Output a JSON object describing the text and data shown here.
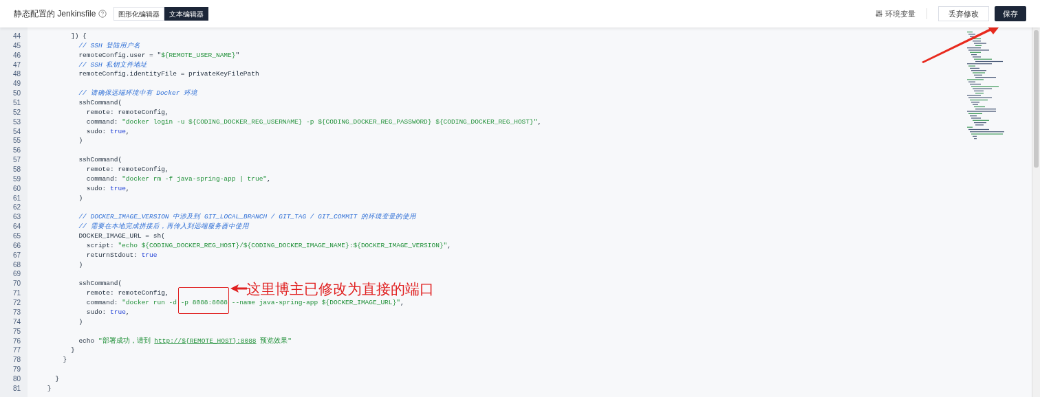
{
  "header": {
    "title": "静态配置的 Jenkinsfile",
    "mode_tabs": [
      {
        "label": "图形化编辑器",
        "selected": false
      },
      {
        "label": "文本编辑器",
        "selected": true
      }
    ],
    "env_button": "环境变量",
    "discard_button": "丢弃修改",
    "save_button": "保存"
  },
  "editor": {
    "lines": [
      {
        "number": "44",
        "segments": [
          {
            "kind": "plain",
            "text": "          ]) {"
          }
        ]
      },
      {
        "number": "45",
        "segments": [
          {
            "kind": "comment",
            "text": "            // SSH 登陆用户名"
          }
        ]
      },
      {
        "number": "46",
        "segments": [
          {
            "kind": "plain",
            "text": "            remoteConfig.user = \""
          },
          {
            "kind": "string",
            "text": "${REMOTE_USER_NAME}"
          },
          {
            "kind": "plain",
            "text": "\""
          }
        ]
      },
      {
        "number": "47",
        "segments": [
          {
            "kind": "comment",
            "text": "            // SSH 私钥文件地址"
          }
        ]
      },
      {
        "number": "48",
        "segments": [
          {
            "kind": "plain",
            "text": "            remoteConfig.identityFile = privateKeyFilePath"
          }
        ]
      },
      {
        "number": "49"
      },
      {
        "number": "50",
        "segments": [
          {
            "kind": "comment",
            "text": "            // 请确保远端环境中有 Docker 环境"
          }
        ]
      },
      {
        "number": "51",
        "segments": [
          {
            "kind": "plain",
            "text": "            sshCommand("
          }
        ]
      },
      {
        "number": "52",
        "segments": [
          {
            "kind": "plain",
            "text": "              remote: remoteConfig,"
          }
        ]
      },
      {
        "number": "53",
        "segments": [
          {
            "kind": "plain",
            "text": "              command: "
          },
          {
            "kind": "string",
            "text": "\"docker login -u ${CODING_DOCKER_REG_USERNAME} -p ${CODING_DOCKER_REG_PASSWORD} ${CODING_DOCKER_REG_HOST}\""
          },
          {
            "kind": "plain",
            "text": ","
          }
        ]
      },
      {
        "number": "54",
        "segments": [
          {
            "kind": "plain",
            "text": "              sudo: "
          },
          {
            "kind": "keyword",
            "text": "true"
          },
          {
            "kind": "plain",
            "text": ","
          }
        ]
      },
      {
        "number": "55",
        "segments": [
          {
            "kind": "plain",
            "text": "            )"
          }
        ]
      },
      {
        "number": "56"
      },
      {
        "number": "57",
        "segments": [
          {
            "kind": "plain",
            "text": "            sshCommand("
          }
        ]
      },
      {
        "number": "58",
        "segments": [
          {
            "kind": "plain",
            "text": "              remote: remoteConfig,"
          }
        ]
      },
      {
        "number": "59",
        "segments": [
          {
            "kind": "plain",
            "text": "              command: "
          },
          {
            "kind": "string",
            "text": "\"docker rm -f java-spring-app | true\""
          },
          {
            "kind": "plain",
            "text": ","
          }
        ]
      },
      {
        "number": "60",
        "segments": [
          {
            "kind": "plain",
            "text": "              sudo: "
          },
          {
            "kind": "keyword",
            "text": "true"
          },
          {
            "kind": "plain",
            "text": ","
          }
        ]
      },
      {
        "number": "61",
        "segments": [
          {
            "kind": "plain",
            "text": "            )"
          }
        ]
      },
      {
        "number": "62"
      },
      {
        "number": "63",
        "segments": [
          {
            "kind": "comment",
            "text": "            // DOCKER_IMAGE_VERSION 中涉及到 GIT_LOCAL_BRANCH / GIT_TAG / GIT_COMMIT 的环境变量的使用"
          }
        ]
      },
      {
        "number": "64",
        "segments": [
          {
            "kind": "comment",
            "text": "            // 需要在本地完成拼接后，再传入到远端服务器中使用"
          }
        ]
      },
      {
        "number": "65",
        "segments": [
          {
            "kind": "plain",
            "text": "            DOCKER_IMAGE_URL = sh("
          }
        ]
      },
      {
        "number": "66",
        "segments": [
          {
            "kind": "plain",
            "text": "              script: "
          },
          {
            "kind": "string",
            "text": "\"echo ${CODING_DOCKER_REG_HOST}/${CODING_DOCKER_IMAGE_NAME}:${DOCKER_IMAGE_VERSION}\""
          },
          {
            "kind": "plain",
            "text": ","
          }
        ]
      },
      {
        "number": "67",
        "segments": [
          {
            "kind": "plain",
            "text": "              returnStdout: "
          },
          {
            "kind": "keyword",
            "text": "true"
          }
        ]
      },
      {
        "number": "68",
        "segments": [
          {
            "kind": "plain",
            "text": "            )"
          }
        ]
      },
      {
        "number": "69"
      },
      {
        "number": "70",
        "segments": [
          {
            "kind": "plain",
            "text": "            sshCommand("
          }
        ]
      },
      {
        "number": "71",
        "segments": [
          {
            "kind": "plain",
            "text": "              remote: remoteConfig,"
          }
        ]
      },
      {
        "number": "72",
        "segments": [
          {
            "kind": "plain",
            "text": "              command: "
          },
          {
            "kind": "string",
            "text": "\"docker run -d -p 8088:8088 --name java-spring-app ${DOCKER_IMAGE_URL}\""
          },
          {
            "kind": "plain",
            "text": ","
          }
        ]
      },
      {
        "number": "73",
        "segments": [
          {
            "kind": "plain",
            "text": "              sudo: "
          },
          {
            "kind": "keyword",
            "text": "true"
          },
          {
            "kind": "plain",
            "text": ","
          }
        ]
      },
      {
        "number": "74",
        "segments": [
          {
            "kind": "plain",
            "text": "            )"
          }
        ]
      },
      {
        "number": "75"
      },
      {
        "number": "76",
        "segments": [
          {
            "kind": "plain",
            "text": "            echo "
          },
          {
            "kind": "string",
            "text": "\"部署成功，请到 "
          },
          {
            "kind": "link",
            "text": "http://${REMOTE_HOST}:8088"
          },
          {
            "kind": "string",
            "text": " 预览效果\""
          }
        ]
      },
      {
        "number": "77",
        "segments": [
          {
            "kind": "plain",
            "text": "          }"
          }
        ]
      },
      {
        "number": "78",
        "segments": [
          {
            "kind": "plain",
            "text": "        }"
          }
        ]
      },
      {
        "number": "79"
      },
      {
        "number": "80",
        "segments": [
          {
            "kind": "plain",
            "text": "      }"
          }
        ]
      },
      {
        "number": "81",
        "segments": [
          {
            "kind": "plain",
            "text": "    }"
          }
        ]
      }
    ]
  },
  "annotation": {
    "text": "这里博主已修改为直接的端口"
  }
}
